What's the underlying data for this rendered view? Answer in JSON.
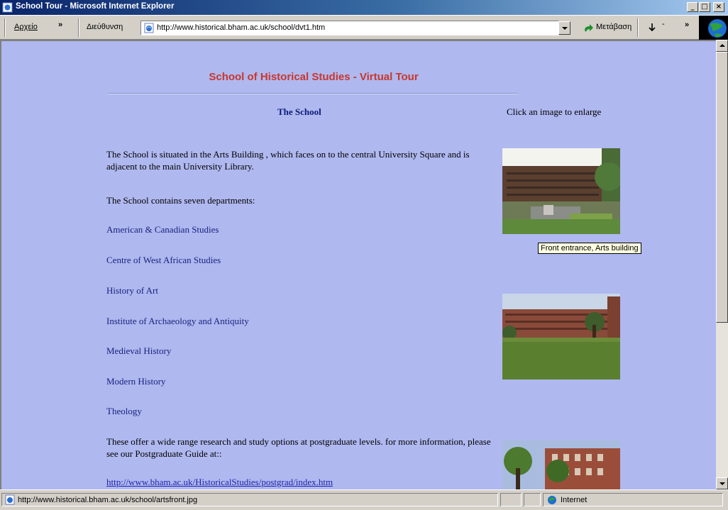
{
  "window": {
    "title": "School Tour - Microsoft Internet Explorer",
    "buttons": {
      "minimize": "_",
      "maximize": "□",
      "close": "×"
    }
  },
  "toolbar": {
    "menu_label": "Αρχείο",
    "overflow_chevron": "»",
    "address_label": "Διεύθυνση",
    "address_url": "http://www.historical.bham.ac.uk/school/dvt1.htm",
    "go_label": "Μετάβαση",
    "links_chevron": "»"
  },
  "page": {
    "heading": "School of Historical Studies - Virtual Tour",
    "section_title": "The School",
    "enlarge_hint": "Click an image to enlarge",
    "intro": "The School is situated in the Arts Building , which faces on to the central University Square and is adjacent to the main University Library.",
    "departments_intro": "The School contains seven departments:",
    "departments": [
      "American & Canadian Studies",
      "Centre of West African Studies",
      "History of Art",
      "Institute  of Archaeology and Antiquity",
      "Medieval History",
      "Modern History",
      "Theology"
    ],
    "postgrad_text": "These offer a wide range research and study options at postgraduate levels. for more information, please see our Postgraduate Guide at::",
    "postgrad_link": "http://www.bham.ac.uk/HistoricalStudies/postgrad/index.htm",
    "tooltip": "Front entrance, Arts building"
  },
  "statusbar": {
    "status_text": "http://www.historical.bham.ac.uk/school/artsfront.jpg",
    "zone": "Internet"
  }
}
